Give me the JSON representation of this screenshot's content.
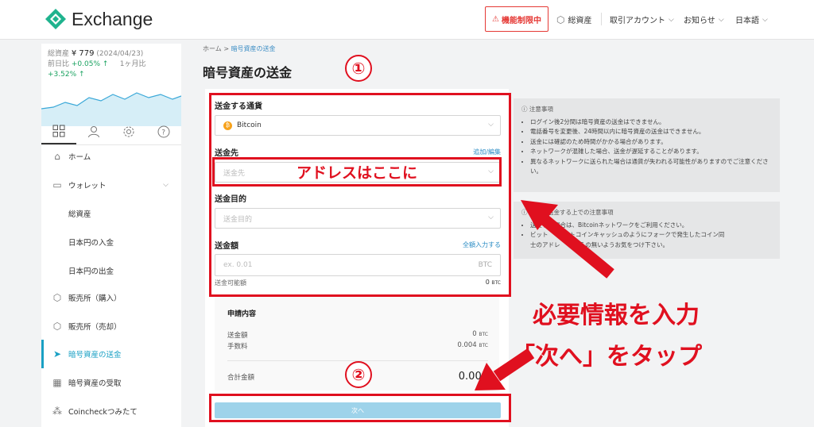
{
  "header": {
    "logo_text": "Exchange",
    "restrict_label": "機能制限中",
    "assets_label": "総資産",
    "account_label": "取引アカウント",
    "news_label": "お知らせ",
    "lang_label": "日本語"
  },
  "balance": {
    "total_label": "総資産",
    "total_value": "¥ 779",
    "date": "(2024/04/23)",
    "day_label": "前日比",
    "day_change": "+0.05% ↑",
    "month_label": "1ヶ月比",
    "month_change": "+3.52% ↑"
  },
  "sidebar": {
    "items": [
      {
        "label": "ホーム"
      },
      {
        "label": "ウォレット"
      },
      {
        "label": "総資産"
      },
      {
        "label": "日本円の入金"
      },
      {
        "label": "日本円の出金"
      },
      {
        "label": "販売所（購入）"
      },
      {
        "label": "販売所（売却）"
      },
      {
        "label": "暗号資産の送金"
      },
      {
        "label": "暗号資産の受取"
      },
      {
        "label": "Coincheckつみたて"
      }
    ]
  },
  "breadcrumb": {
    "home": "ホーム",
    "sep": ">",
    "current": "暗号資産の送金"
  },
  "page_title": "暗号資産の送金",
  "form": {
    "currency_label": "送金する通貨",
    "currency_value": "Bitcoin",
    "dest_label": "送金先",
    "dest_link": "追加/編集",
    "dest_placeholder": "送金先",
    "purpose_label": "送金目的",
    "purpose_placeholder": "送金目的",
    "amount_label": "送金額",
    "amount_link": "全額入力する",
    "amount_placeholder": "ex. 0.01",
    "amount_unit": "BTC",
    "available_label": "送金可能額",
    "available_value": "0",
    "available_unit": "BTC"
  },
  "summary": {
    "title": "申請内容",
    "amount_label": "送金額",
    "amount_value": "0",
    "amount_unit": "BTC",
    "fee_label": "手数料",
    "fee_value": "0.004",
    "fee_unit": "BTC",
    "total_label": "合計金額",
    "total_value": "0.004"
  },
  "next_button": "次へ",
  "notice1": {
    "title": "注意事項",
    "items": [
      "ログイン後2分間は暗号資産の送金はできません。",
      "電話番号を変更後、24時間以内に暗号資産の送金はできません。",
      "送金には確認のため時間がかかる場合があります。",
      "ネットワークが混雑した場合、送金が遅延することがあります。",
      "異なるネットワークに送られた場合は通貨が失われる可能性がありますのでご注意ください。"
    ]
  },
  "notice2": {
    "title_visible": "coinを送金する上での注意事項",
    "item1_visible": "送金する場合は、Bitcoinネットワークをご利用ください。",
    "item2_a": "ビット",
    "item2_b": "ビットコインキャッシュのようにフォークで発生したコイン同",
    "item2_c": "士のアドレ",
    "item2_d": "違えの無いようお気をつけ下さい。"
  },
  "annotations": {
    "circle1": "①",
    "circle2": "②",
    "address_here": "アドレスはここに",
    "line1": "必要情報を入力",
    "line2": "「次へ」をタップ"
  },
  "colors": {
    "accent": "#e0101f",
    "brand": "#1fb38e",
    "link": "#2b8cc4",
    "button": "#9ed3ea"
  }
}
